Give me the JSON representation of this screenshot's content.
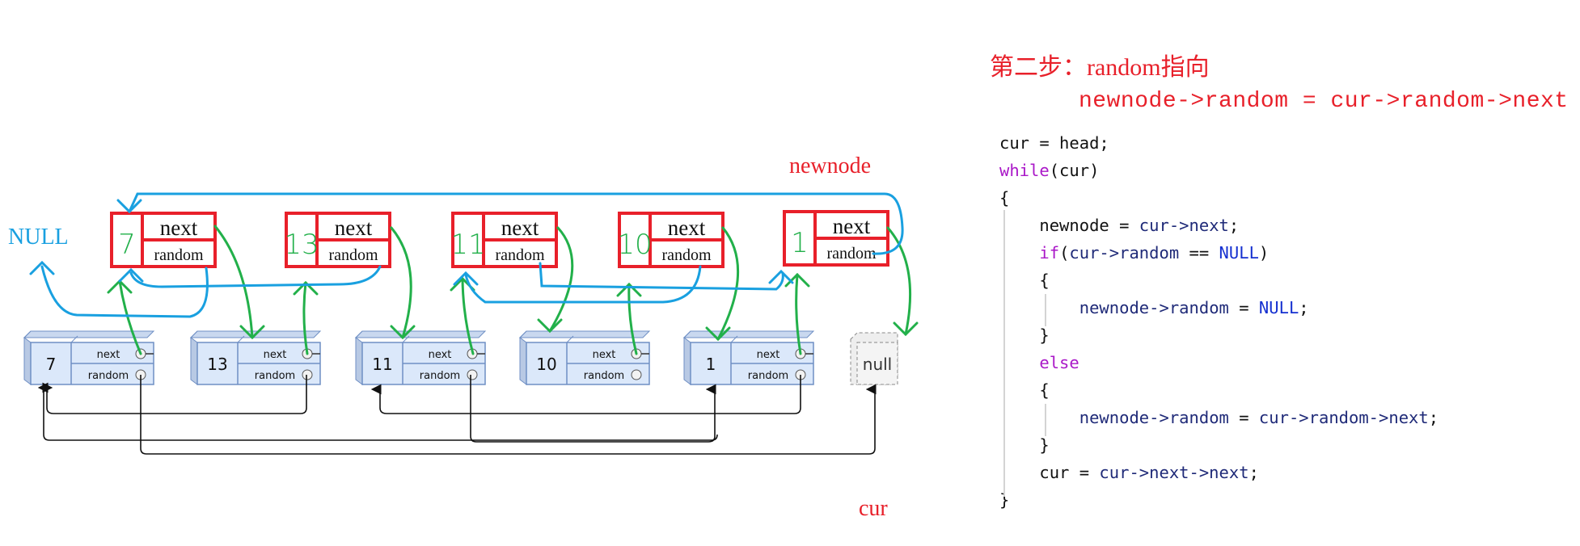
{
  "step_title": "第二步：random指向",
  "formula": "newnode->random = cur->random->next",
  "labels": {
    "newnode": "newnode",
    "cur": "cur",
    "null_label": "NULL"
  },
  "original_nodes": [
    {
      "val": "7",
      "next_label": "next",
      "random_label": "random"
    },
    {
      "val": "13",
      "next_label": "next",
      "random_label": "random"
    },
    {
      "val": "11",
      "next_label": "next",
      "random_label": "random"
    },
    {
      "val": "10",
      "next_label": "next",
      "random_label": "random"
    },
    {
      "val": "1",
      "next_label": "next",
      "random_label": "random"
    }
  ],
  "null_node": "null",
  "copy_nodes": [
    {
      "val": "7",
      "next_label": "next",
      "random_label": "random"
    },
    {
      "val": "13",
      "next_label": "next",
      "random_label": "random"
    },
    {
      "val": "11",
      "next_label": "next",
      "random_label": "random"
    },
    {
      "val": "10",
      "next_label": "next",
      "random_label": "random"
    },
    {
      "val": "1",
      "next_label": "next",
      "random_label": "random"
    }
  ],
  "original_random_targets": [
    "null",
    "7",
    "1",
    "11",
    "7"
  ],
  "copy_random_targets": [
    "NULL",
    "7",
    "1",
    "11",
    "7"
  ],
  "colors": {
    "title_red": "#e8202a",
    "copy_box_red": "#e8202a",
    "next_arrow_green": "#22b04a",
    "random_arrow_blue": "#19a0e0",
    "node_fill": "#dbe8fa",
    "node_stroke": "#6f8fc4"
  },
  "code": [
    [
      {
        "t": "cur = head;",
        "c": "plain"
      }
    ],
    [
      {
        "t": "while",
        "c": "kw"
      },
      {
        "t": "(cur)",
        "c": "plain"
      }
    ],
    [
      {
        "t": "{",
        "c": "plain"
      }
    ],
    [
      {
        "t": "    newnode = ",
        "c": "plain"
      },
      {
        "t": "cur->next",
        "c": "id"
      },
      {
        "t": ";",
        "c": "plain"
      }
    ],
    [
      {
        "t": "    ",
        "c": "plain"
      },
      {
        "t": "if",
        "c": "kw"
      },
      {
        "t": "(",
        "c": "plain"
      },
      {
        "t": "cur->random",
        "c": "id"
      },
      {
        "t": " == ",
        "c": "plain"
      },
      {
        "t": "NULL",
        "c": "const"
      },
      {
        "t": ")",
        "c": "plain"
      }
    ],
    [
      {
        "t": "    {",
        "c": "plain"
      }
    ],
    [
      {
        "t": "        ",
        "c": "plain"
      },
      {
        "t": "newnode->random",
        "c": "id"
      },
      {
        "t": " = ",
        "c": "plain"
      },
      {
        "t": "NULL",
        "c": "const"
      },
      {
        "t": ";",
        "c": "plain"
      }
    ],
    [
      {
        "t": "    }",
        "c": "plain"
      }
    ],
    [
      {
        "t": "    ",
        "c": "plain"
      },
      {
        "t": "else",
        "c": "kw"
      }
    ],
    [
      {
        "t": "    {",
        "c": "plain"
      }
    ],
    [
      {
        "t": "        ",
        "c": "plain"
      },
      {
        "t": "newnode->random",
        "c": "id"
      },
      {
        "t": " = ",
        "c": "plain"
      },
      {
        "t": "cur->random->next",
        "c": "id"
      },
      {
        "t": ";",
        "c": "plain"
      }
    ],
    [
      {
        "t": "    }",
        "c": "plain"
      }
    ],
    [
      {
        "t": "    cur = ",
        "c": "plain"
      },
      {
        "t": "cur->next->next",
        "c": "id"
      },
      {
        "t": ";",
        "c": "plain"
      }
    ],
    [
      {
        "t": "}",
        "c": "plain"
      }
    ]
  ]
}
